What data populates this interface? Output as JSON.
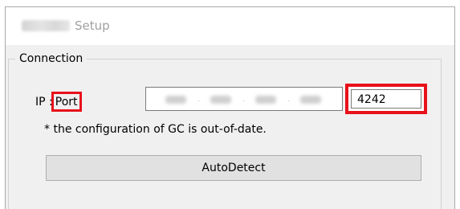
{
  "window": {
    "title": "Setup"
  },
  "connection": {
    "legend": "Connection",
    "ip_label_prefix": "IP",
    "ip_label_separator": ":",
    "port_label": "Port",
    "ip_value": "",
    "port_value": "4242",
    "note": "* the configuration of GC is out-of-date.",
    "autodetect_label": "AutoDetect"
  },
  "colors": {
    "highlight": "#e8111b",
    "window_bg": "#f0f0f0",
    "button_bg": "#e1e1e1"
  }
}
